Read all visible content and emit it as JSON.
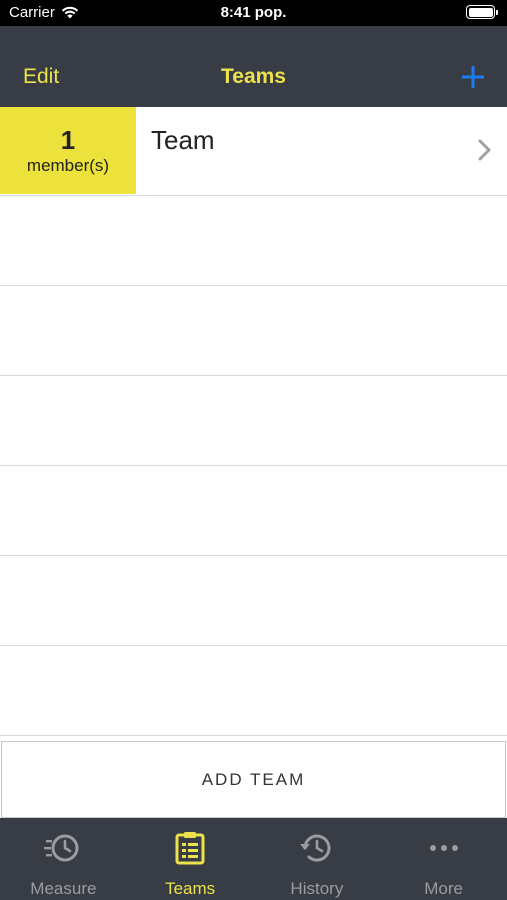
{
  "status_bar": {
    "carrier": "Carrier",
    "time": "8:41 pop."
  },
  "nav": {
    "edit_label": "Edit",
    "title": "Teams",
    "add_icon": "plus-icon",
    "accent_color": "#ece24b",
    "add_color": "#1a7cf5"
  },
  "teams": [
    {
      "member_count": "1",
      "member_label": "member(s)",
      "name": "Team"
    }
  ],
  "add_team_label": "ADD TEAM",
  "tab_bar": {
    "active": "Teams",
    "tabs": [
      {
        "label": "Measure",
        "icon": "stopwatch-icon"
      },
      {
        "label": "Teams",
        "icon": "clipboard-list-icon"
      },
      {
        "label": "History",
        "icon": "history-icon"
      },
      {
        "label": "More",
        "icon": "more-dots-icon"
      }
    ]
  }
}
